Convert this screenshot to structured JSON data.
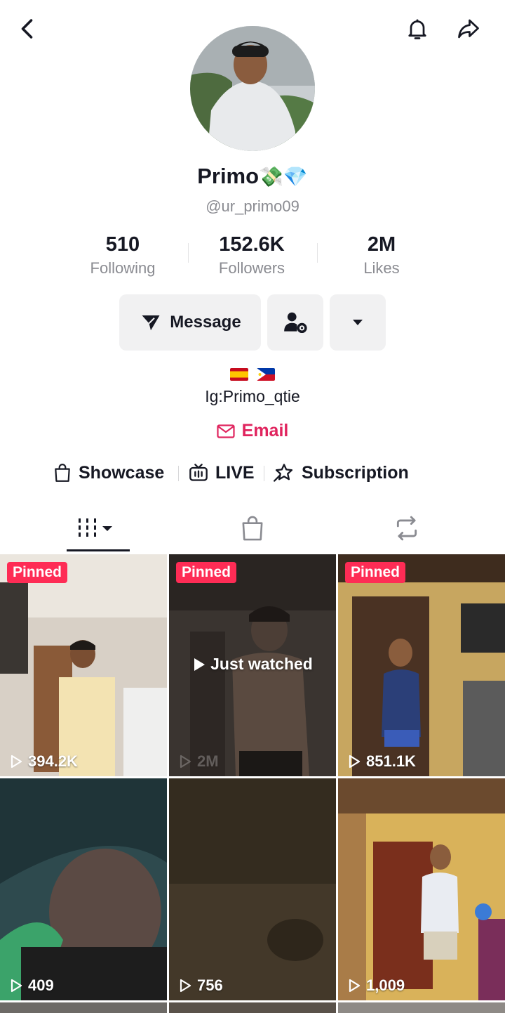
{
  "profile": {
    "display_name": "Primo",
    "name_emojis": "💸💎",
    "username": "@ur_primo09",
    "bio": "Ig:Primo_qtie",
    "flags": [
      "es-flag",
      "ph-flag"
    ],
    "email_label": "Email"
  },
  "stats": {
    "following": {
      "value": "510",
      "label": "Following"
    },
    "followers": {
      "value": "152.6K",
      "label": "Followers"
    },
    "likes": {
      "value": "2M",
      "label": "Likes"
    }
  },
  "actions": {
    "message_label": "Message"
  },
  "links": {
    "showcase": "Showcase",
    "live": "LIVE",
    "subscription": "Subscription"
  },
  "tabs": [
    "videos-grid-icon",
    "shop-bag-icon",
    "repost-icon"
  ],
  "videos": [
    {
      "pinned": "Pinned",
      "views": "394.2K"
    },
    {
      "pinned": "Pinned",
      "views": "2M",
      "overlay": "Just watched"
    },
    {
      "pinned": "Pinned",
      "views": "851.1K"
    },
    {
      "views": "409"
    },
    {
      "views": "756"
    },
    {
      "views": "1,009"
    }
  ],
  "colors": {
    "accent": "#fe2c55",
    "email": "#e0245e",
    "text": "#161823",
    "muted": "#8a8b91"
  }
}
